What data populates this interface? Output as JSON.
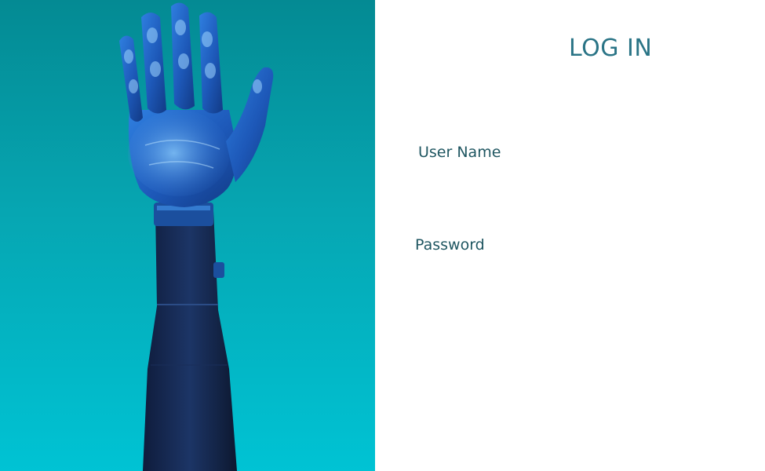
{
  "hero": {
    "image": "robotic-hand-raised"
  },
  "login": {
    "title": "LOG IN",
    "username": {
      "label": "User Name",
      "value": "",
      "placeholder": ""
    },
    "password": {
      "label": "Password",
      "value": "",
      "placeholder": ""
    }
  },
  "colors": {
    "hero_gradient_top": "#048a93",
    "hero_gradient_bottom": "#00c3d4",
    "title": "#2a7486",
    "label": "#1f5661",
    "panel_background": "#ffffff"
  }
}
